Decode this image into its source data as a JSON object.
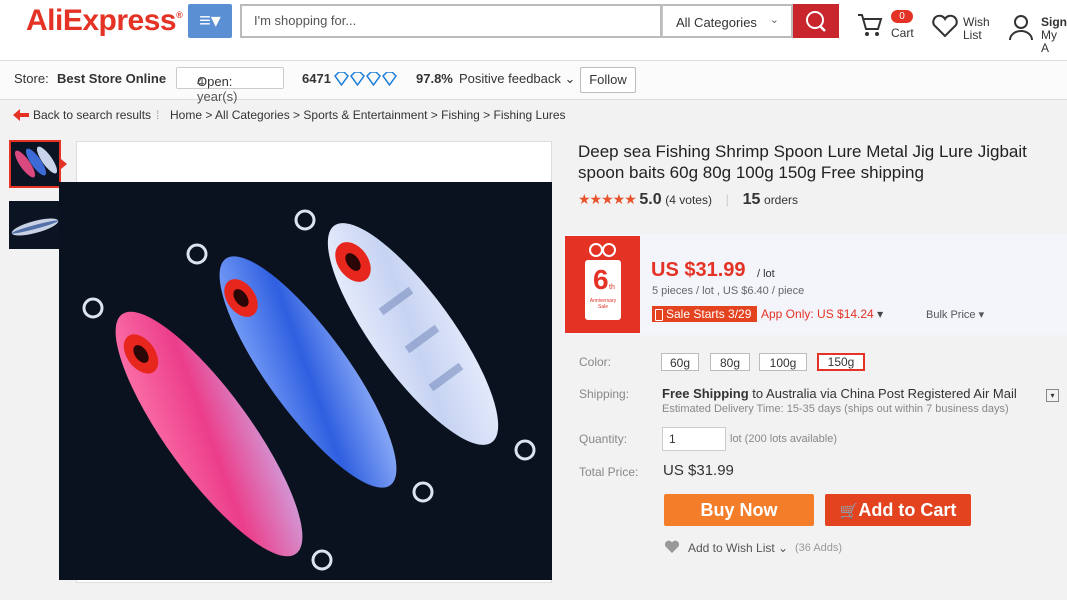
{
  "header": {
    "logo": "AliExpress",
    "logo_tm": "®",
    "search_placeholder": "I'm shopping for...",
    "category": "All Categories",
    "cart_label": "Cart",
    "cart_count": "0",
    "wish_label_1": "Wish",
    "wish_label_2": "List",
    "sign_label_1": "Sign",
    "sign_label_2": "My A"
  },
  "store": {
    "label": "Store:",
    "name": "Best Store Online",
    "open_label": "Open:",
    "open_value": "4 year(s)",
    "score": "6471",
    "feedback_pct": "97.8%",
    "feedback_label": "Positive feedback",
    "follow": "Follow"
  },
  "breadcrumb": {
    "back": "Back to search results",
    "path": "Home > All Categories > Sports & Entertainment > Fishing > Fishing Lures"
  },
  "product": {
    "title": "Deep sea Fishing Shrimp Spoon Lure Metal Jig Lure Jigbait spoon baits 60g 80g 100g 150g Free shipping",
    "rating_value": "5.0",
    "votes": "(4 votes)",
    "orders_count": "15",
    "orders_label": "orders",
    "price": "US $31.99",
    "price_unit": "/ lot",
    "price_sub": "5 pieces / lot , US $6.40 / piece",
    "sale_badge": "Sale Starts 3/29",
    "app_only": "App Only: US $14.24",
    "bulk_price": "Bulk Price",
    "anniversary": "6",
    "anniversary_sup": "th",
    "anniversary_text": "Anniversary Sale",
    "color_label": "Color:",
    "colors": [
      "60g",
      "80g",
      "100g",
      "150g"
    ],
    "shipping_label": "Shipping:",
    "shipping_free": "Free Shipping",
    "shipping_to": "to",
    "shipping_dest": "Australia via China Post Registered Air Mail",
    "delivery_time": "Estimated Delivery Time: 15-35 days (ships out within 7 business days)",
    "quantity_label": "Quantity:",
    "quantity_value": "1",
    "quantity_avail": "lot (200 lots available)",
    "total_label": "Total Price:",
    "total_value": "US $31.99",
    "buy_now": "Buy Now",
    "add_to_cart": "Add to Cart",
    "wishlist": "Add to Wish List",
    "adds": "(36 Adds)"
  },
  "colors": {
    "brand_red": "#e43225",
    "buy_orange": "#f47d2a",
    "cart_red": "#e4431f"
  }
}
